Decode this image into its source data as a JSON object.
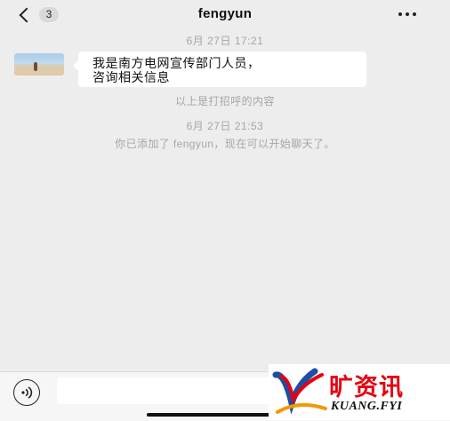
{
  "header": {
    "back_label": "<",
    "unread_count": "3",
    "title": "fengyun",
    "more_icon": "more-dots-icon"
  },
  "chat": {
    "timestamp_1": "6月 27日 17:21",
    "message_1": {
      "sender": "fengyun",
      "line_1": "我是南方电网宣传部门人员，",
      "line_2": "咨询相关信息"
    },
    "system_note_1": "以上是打招呼的内容",
    "timestamp_2": "6月 27日 21:53",
    "system_note_2": "你已添加了 fengyun，现在可以开始聊天了。"
  },
  "input_bar": {
    "voice_icon": "voice-input-icon",
    "text_value": "",
    "placeholder": ""
  },
  "watermark": {
    "cn": "旷资讯",
    "en": "KUANG.FYI",
    "colors": {
      "red": "#e60012",
      "blue": "#1a4fa3",
      "orange": "#f39800"
    }
  }
}
